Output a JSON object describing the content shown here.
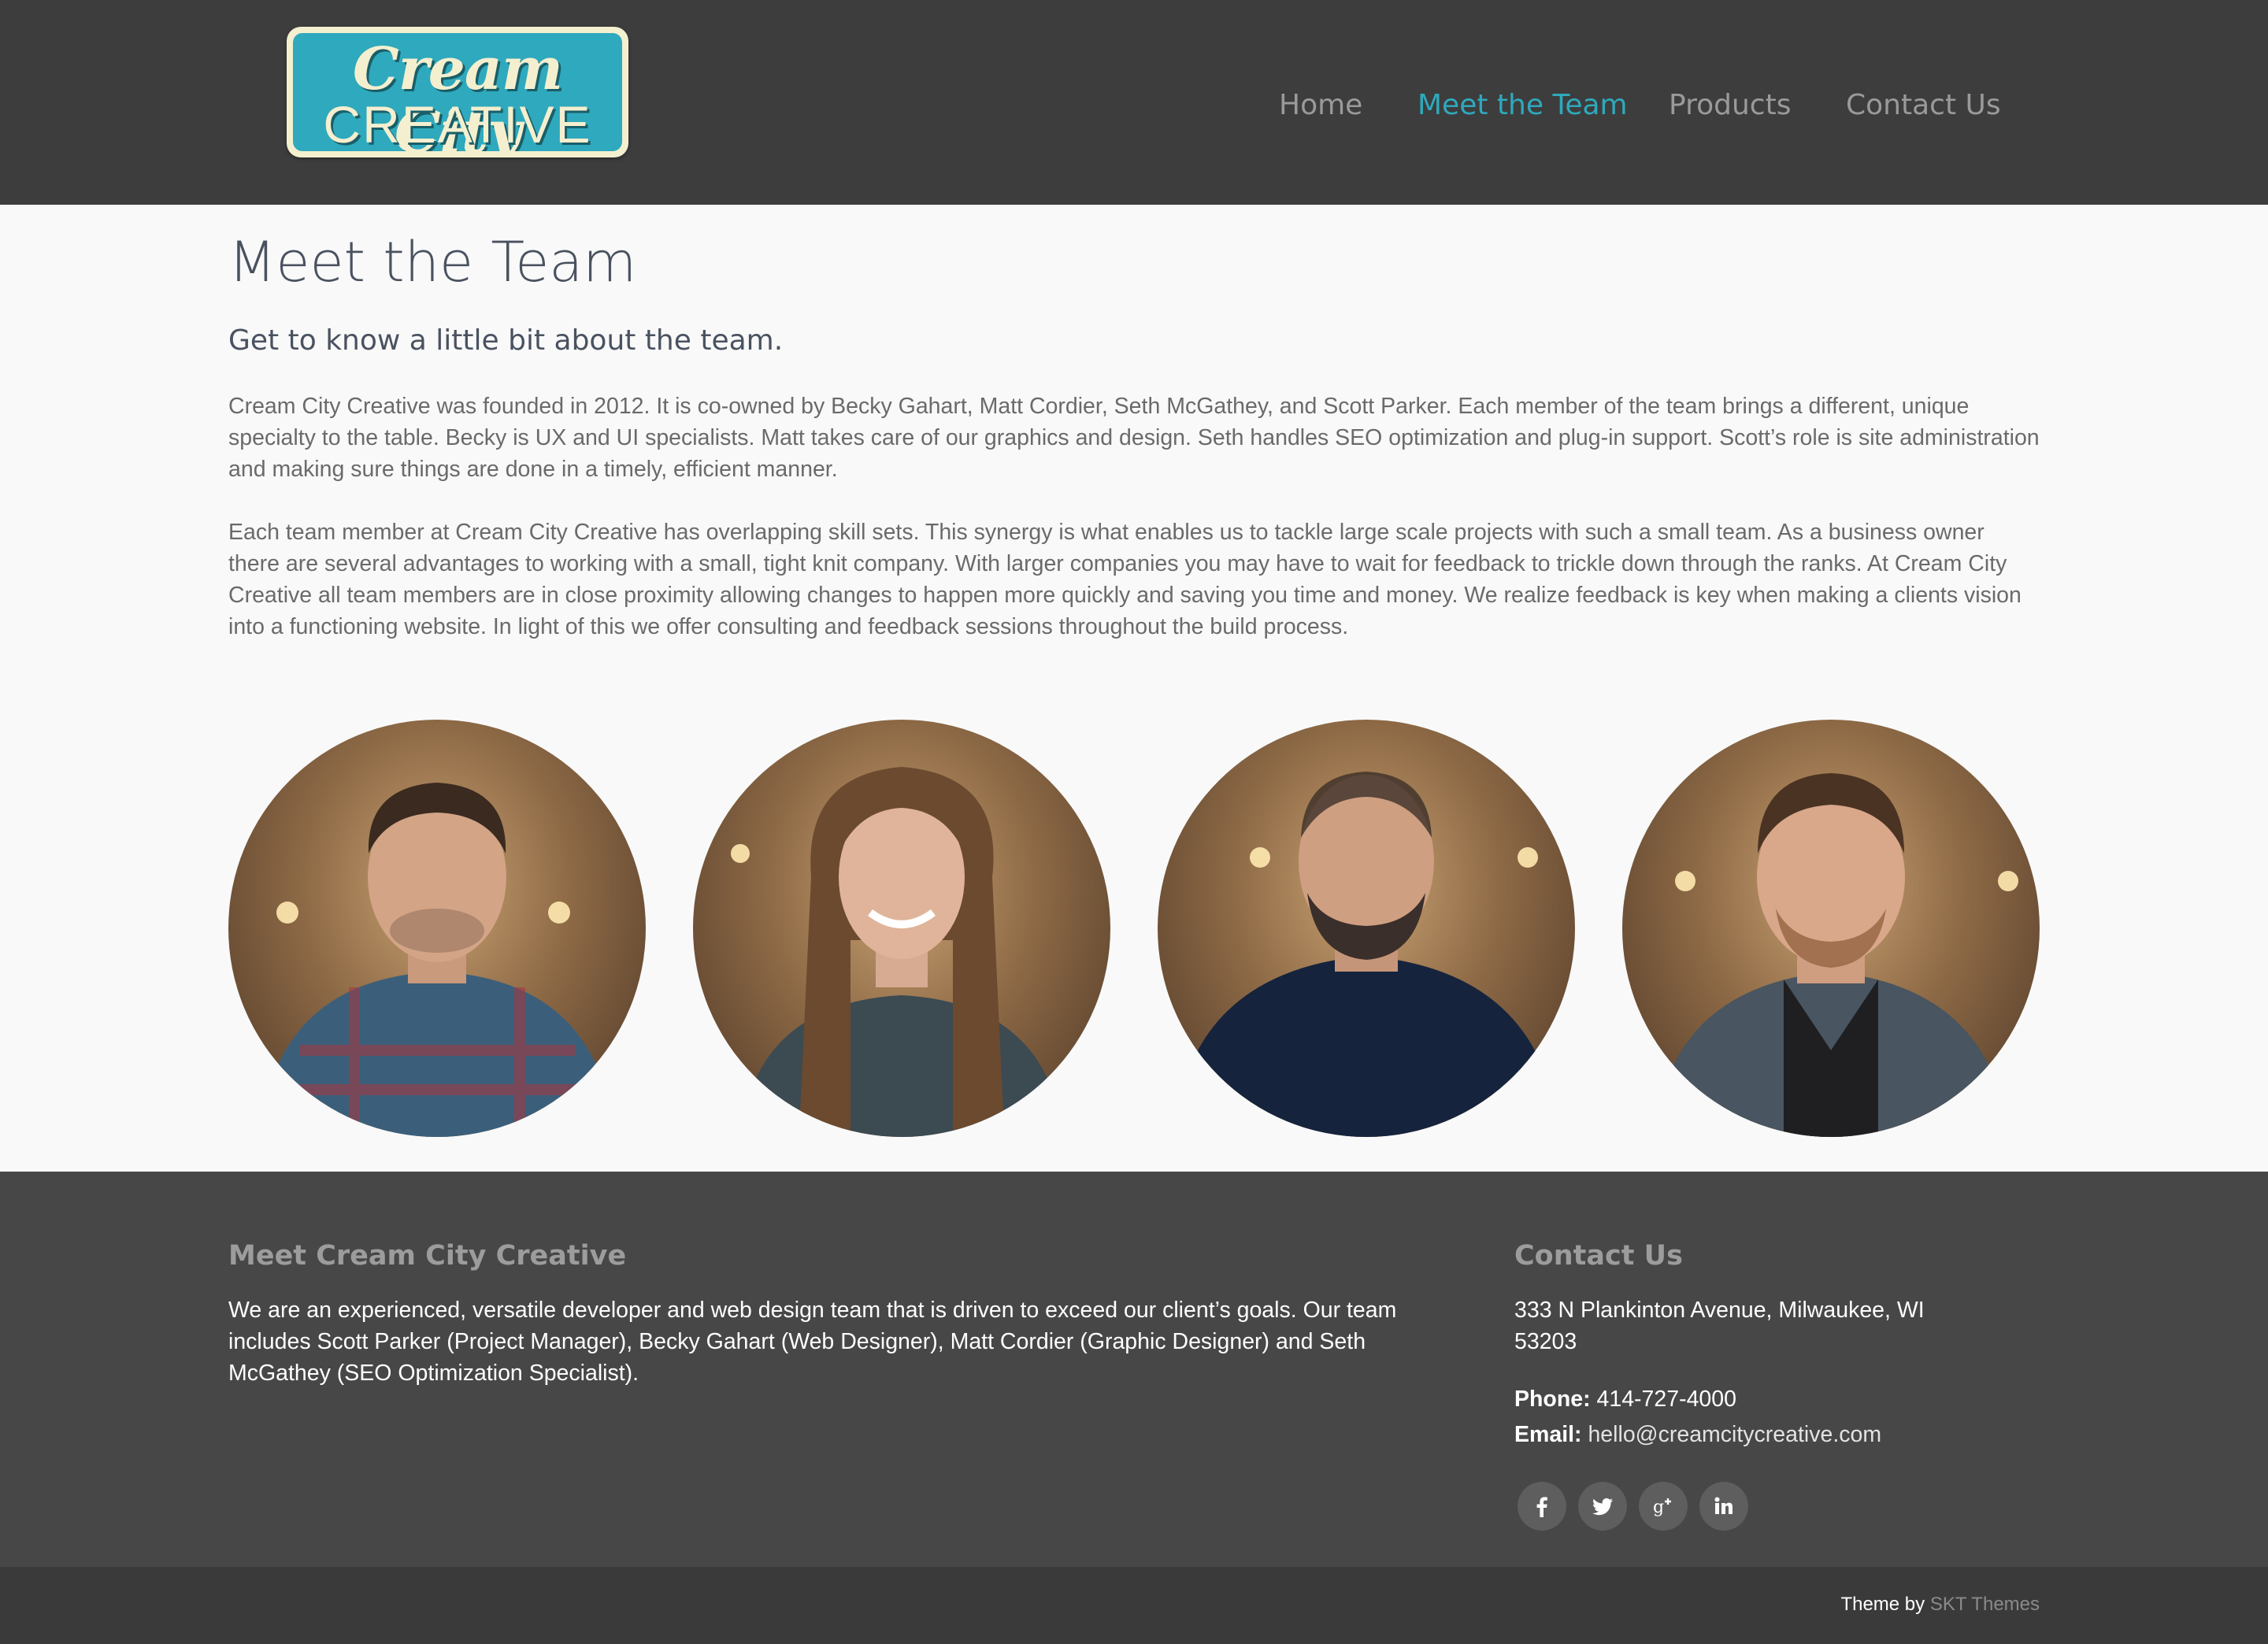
{
  "header": {
    "logo": {
      "line1": "Cream City",
      "line2": "CREATIVE"
    },
    "nav": [
      {
        "label": "Home",
        "active": false
      },
      {
        "label": "Meet the Team",
        "active": true
      },
      {
        "label": "Products",
        "active": false
      },
      {
        "label": "Contact Us",
        "active": false
      }
    ]
  },
  "main": {
    "title": "Meet the Team",
    "subtitle": "Get to know a little bit about the team.",
    "paragraphs": [
      "Cream City Creative was founded in 2012. It is co-owned by Becky Gahart, Matt Cordier, Seth McGathey, and Scott Parker. Each member of the team brings a different, unique specialty to the table. Becky is UX and UI specialists. Matt takes care of our graphics and design. Seth handles SEO optimization and plug-in support. Scott’s role is site administration and making sure things are done in a timely, efficient manner.",
      "Each team member at Cream City Creative has overlapping skill sets. This synergy is what enables us to tackle large scale projects with such a small team. As a business owner there are several advantages to working with a small, tight knit company. With larger companies you may have to wait for feedback to trickle down through the ranks. At Cream City Creative all team members are in close proximity allowing changes to happen more quickly and saving you time and money. We realize feedback is key when making a clients vision into a functioning website. In light of this we offer consulting and feedback sessions throughout the build process."
    ],
    "portraits": [
      "team-member-portrait",
      "team-member-portrait",
      "team-member-portrait",
      "team-member-portrait"
    ]
  },
  "footer": {
    "about": {
      "title": "Meet Cream City Creative",
      "text": "We are an experienced, versatile developer and web design team that is driven to exceed our client’s goals. Our team includes Scott Parker (Project Manager), Becky Gahart (Web Designer), Matt Cordier (Graphic Designer) and Seth McGathey (SEO Optimization Specialist)."
    },
    "contact": {
      "title": "Contact Us",
      "address": "333 N Plankinton Avenue, Milwaukee, WI 53203",
      "phone_label": "Phone:",
      "phone": "414-727-4000",
      "email_label": "Email:",
      "email": "hello@creamcitycreative.com",
      "social": [
        "facebook-icon",
        "twitter-icon",
        "google-plus-icon",
        "linkedin-icon"
      ]
    },
    "credit": {
      "prefix": "Theme by",
      "link": "SKT Themes"
    }
  },
  "colors": {
    "header_bg": "#3d3d3d",
    "accent": "#2ea9bd",
    "page_bg": "#f9f9f9",
    "footer_bg": "#474747",
    "bottombar_bg": "#3a3a3a"
  }
}
